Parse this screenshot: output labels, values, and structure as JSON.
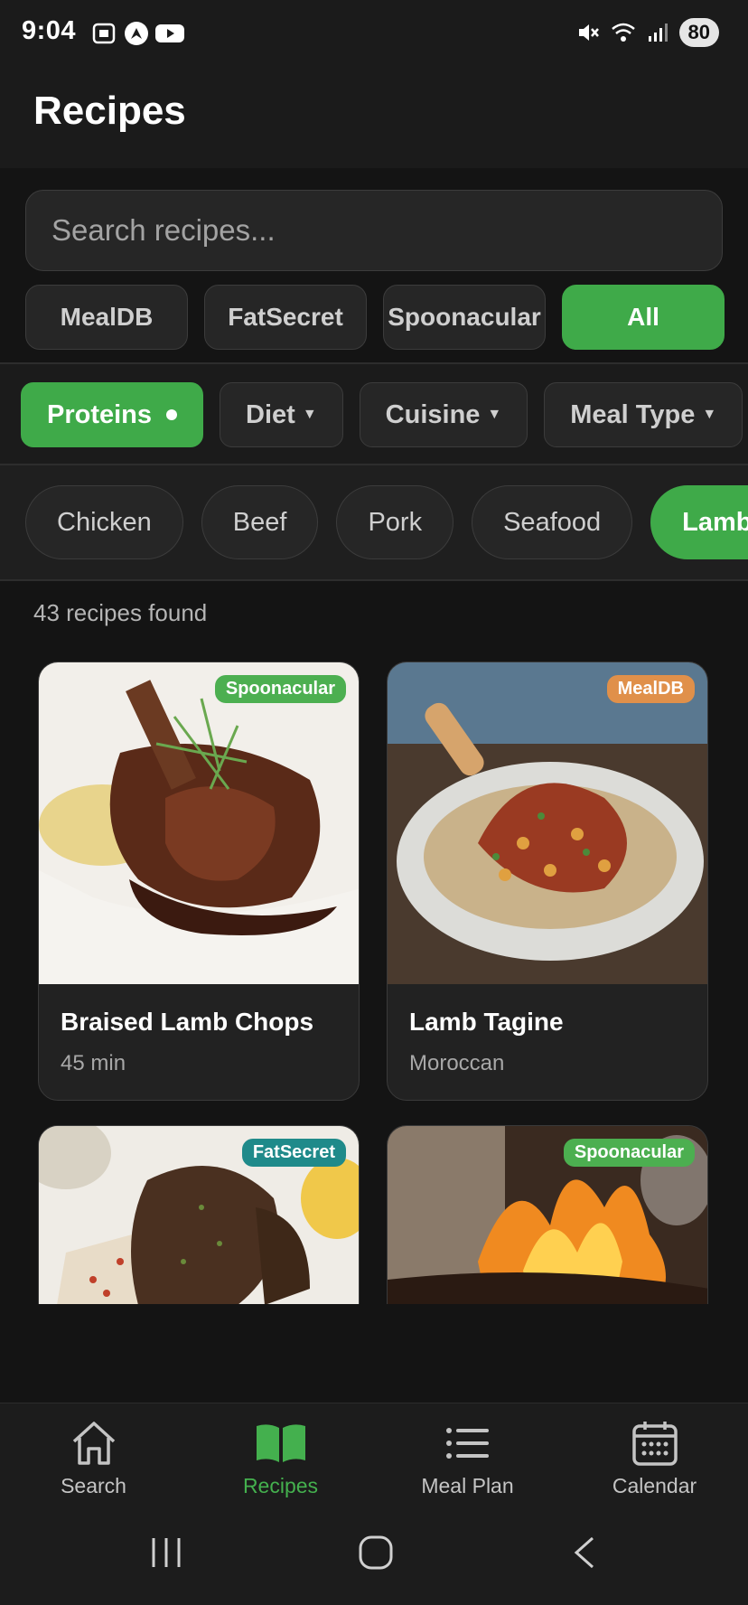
{
  "status_bar": {
    "time": "9:04",
    "battery": "80",
    "icons_left": [
      "screenshot-icon",
      "nav-app-icon",
      "youtube-icon"
    ],
    "icons_right": [
      "mute-icon",
      "wifi-icon",
      "signal-icon"
    ]
  },
  "header": {
    "title": "Recipes"
  },
  "search": {
    "placeholder": "Search recipes..."
  },
  "sources": [
    {
      "label": "MealDB",
      "active": false
    },
    {
      "label": "FatSecret",
      "active": false
    },
    {
      "label": "Spoonacular",
      "active": false
    },
    {
      "label": "All",
      "active": true
    }
  ],
  "filters": [
    {
      "label": "Proteins",
      "active": true
    },
    {
      "label": "Diet",
      "active": false
    },
    {
      "label": "Cuisine",
      "active": false
    },
    {
      "label": "Meal Type",
      "active": false
    }
  ],
  "proteins": [
    {
      "label": "Chicken",
      "active": false
    },
    {
      "label": "Beef",
      "active": false
    },
    {
      "label": "Pork",
      "active": false
    },
    {
      "label": "Seafood",
      "active": false
    },
    {
      "label": "Lamb",
      "active": true
    }
  ],
  "results": {
    "count_text": "43 recipes found"
  },
  "recipes": [
    {
      "title": "Braised Lamb Chops",
      "subtitle": "45 min",
      "source": "Spoonacular"
    },
    {
      "title": "Lamb Tagine",
      "subtitle": "Moroccan",
      "source": "MealDB"
    },
    {
      "title": "",
      "subtitle": "",
      "source": "FatSecret"
    },
    {
      "title": "",
      "subtitle": "",
      "source": "Spoonacular"
    }
  ],
  "colors": {
    "accent": "#3faa49",
    "badge_spoonacular": "#4caf50",
    "badge_mealdb": "#e0904a",
    "badge_fatsecret": "#1f8a8a"
  },
  "bottom_nav": [
    {
      "label": "Search",
      "icon": "home-icon",
      "active": false
    },
    {
      "label": "Recipes",
      "icon": "book-icon",
      "active": true
    },
    {
      "label": "Meal Plan",
      "icon": "list-icon",
      "active": false
    },
    {
      "label": "Calendar",
      "icon": "calendar-icon",
      "active": false
    }
  ]
}
